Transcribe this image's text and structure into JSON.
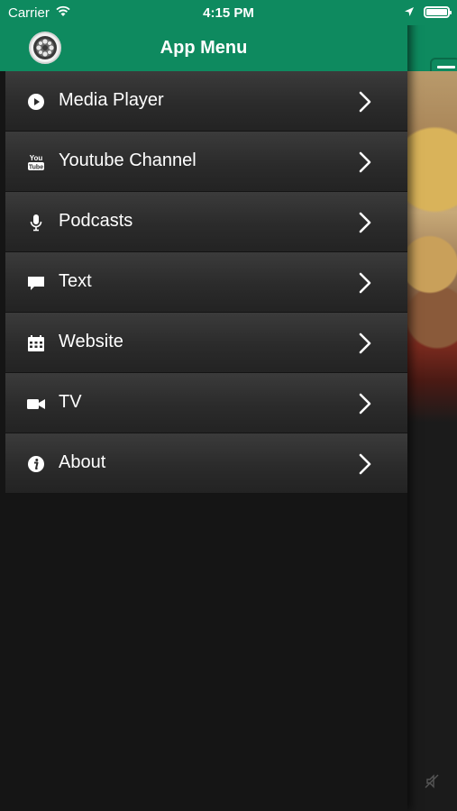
{
  "status_bar": {
    "carrier": "Carrier",
    "time": "4:15 PM"
  },
  "drawer": {
    "title": "App Menu",
    "items": [
      {
        "label": "Media Player",
        "icon": "play-circle-icon"
      },
      {
        "label": "Youtube Channel",
        "icon": "youtube-icon"
      },
      {
        "label": "Podcasts",
        "icon": "microphone-icon"
      },
      {
        "label": "Text",
        "icon": "chat-bubble-icon"
      },
      {
        "label": "Website",
        "icon": "calendar-icon"
      },
      {
        "label": "TV",
        "icon": "video-camera-icon"
      },
      {
        "label": "About",
        "icon": "info-icon"
      }
    ]
  },
  "colors": {
    "header_green": "#0e8a5f",
    "menu_item_bg": "#2b2b2b",
    "background": "#141414"
  }
}
